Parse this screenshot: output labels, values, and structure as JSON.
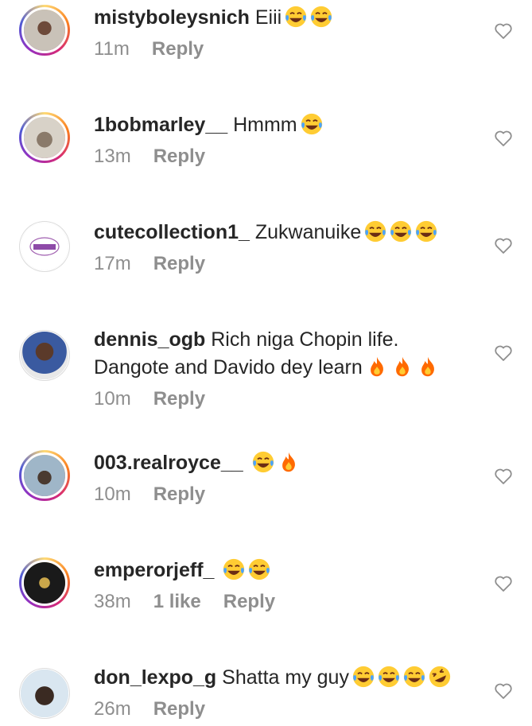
{
  "comments": [
    {
      "username": "mistyboleysnich",
      "text": "Eiii",
      "emojis": [
        "laughing-tears",
        "laughing-tears"
      ],
      "time": "11m",
      "likes": "",
      "reply": "Reply",
      "ring": true
    },
    {
      "username": "1bobmarley__",
      "text": "Hmmm",
      "emojis": [
        "laughing-tears"
      ],
      "time": "13m",
      "likes": "",
      "reply": "Reply",
      "ring": true
    },
    {
      "username": "cutecollection1_",
      "text": "Zukwanuike",
      "emojis": [
        "laughing-tears",
        "laughing-tears",
        "laughing-tears"
      ],
      "time": "17m",
      "likes": "",
      "reply": "Reply",
      "ring": false
    },
    {
      "username": "dennis_ogb",
      "text": "Rich niga Chopin life.",
      "text2": "Dangote and Davido dey learn",
      "emojis": [
        "fire",
        "fire",
        "fire"
      ],
      "time": "10m",
      "likes": "",
      "reply": "Reply",
      "ring": false
    },
    {
      "username": "003.realroyce__",
      "text": "",
      "emojis": [
        "laughing-tears",
        "fire"
      ],
      "time": "10m",
      "likes": "",
      "reply": "Reply",
      "ring": true
    },
    {
      "username": "emperorjeff_",
      "text": "",
      "emojis": [
        "laughing-tears",
        "laughing-tears"
      ],
      "time": "38m",
      "likes": "1 like",
      "reply": "Reply",
      "ring": true
    },
    {
      "username": "don_lexpo_g",
      "text": "Shatta my guy",
      "emojis": [
        "laughing-tears",
        "laughing-tears",
        "laughing-tears",
        "rolling-laughing"
      ],
      "time": "26m",
      "likes": "",
      "reply": "Reply",
      "ring": false
    }
  ],
  "icons": {
    "like": "heart-outline-icon"
  },
  "colors": {
    "secondary_text": "#8e8e8e",
    "primary_text": "#262626",
    "emoji_yellow": "#ffcc33",
    "fire_orange": "#ff6a00"
  }
}
